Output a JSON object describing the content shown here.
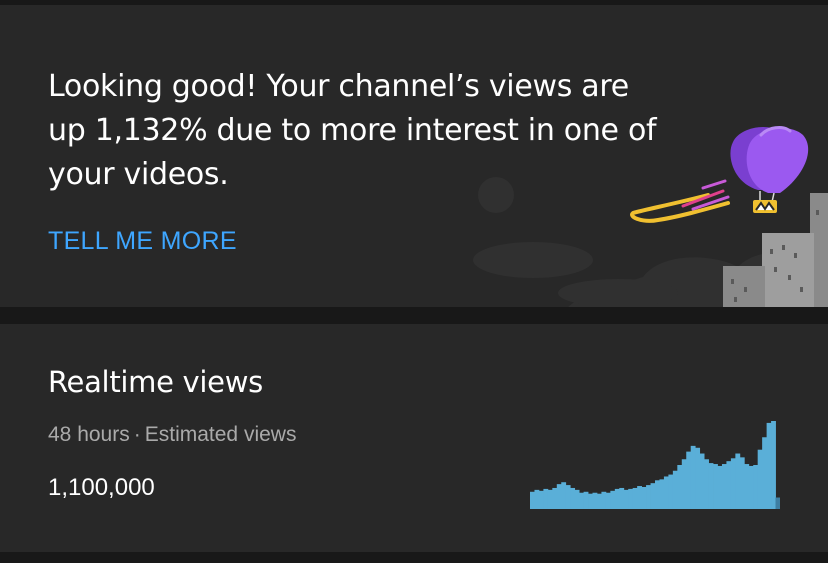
{
  "insight_card": {
    "message": "Looking good! Your channel’s views are up 1,132% due to more interest in one of your videos.",
    "action_label": "TELL ME MORE",
    "illustration": "hot-air-balloon-over-city"
  },
  "realtime_card": {
    "title": "Realtime views",
    "period": "48 hours",
    "separator": "·",
    "metric": "Estimated views",
    "total": "1,100,000",
    "bar_color": "#5aafd8"
  },
  "colors": {
    "background": "#181818",
    "card": "#282828",
    "accent": "#3ea6ff",
    "balloon": "#9b59f0",
    "streak": "#f0c030"
  },
  "chart_data": {
    "type": "bar",
    "description_period": "48 hours",
    "values": [
      18,
      20,
      19,
      21,
      20,
      22,
      26,
      28,
      25,
      22,
      20,
      17,
      18,
      16,
      17,
      16,
      18,
      17,
      19,
      21,
      22,
      20,
      21,
      22,
      24,
      23,
      25,
      27,
      30,
      31,
      34,
      36,
      40,
      46,
      52,
      60,
      66,
      64,
      58,
      52,
      48,
      47,
      45,
      47,
      50,
      53,
      58,
      54,
      47,
      45,
      46,
      62,
      75,
      90,
      92,
      12
    ]
  }
}
